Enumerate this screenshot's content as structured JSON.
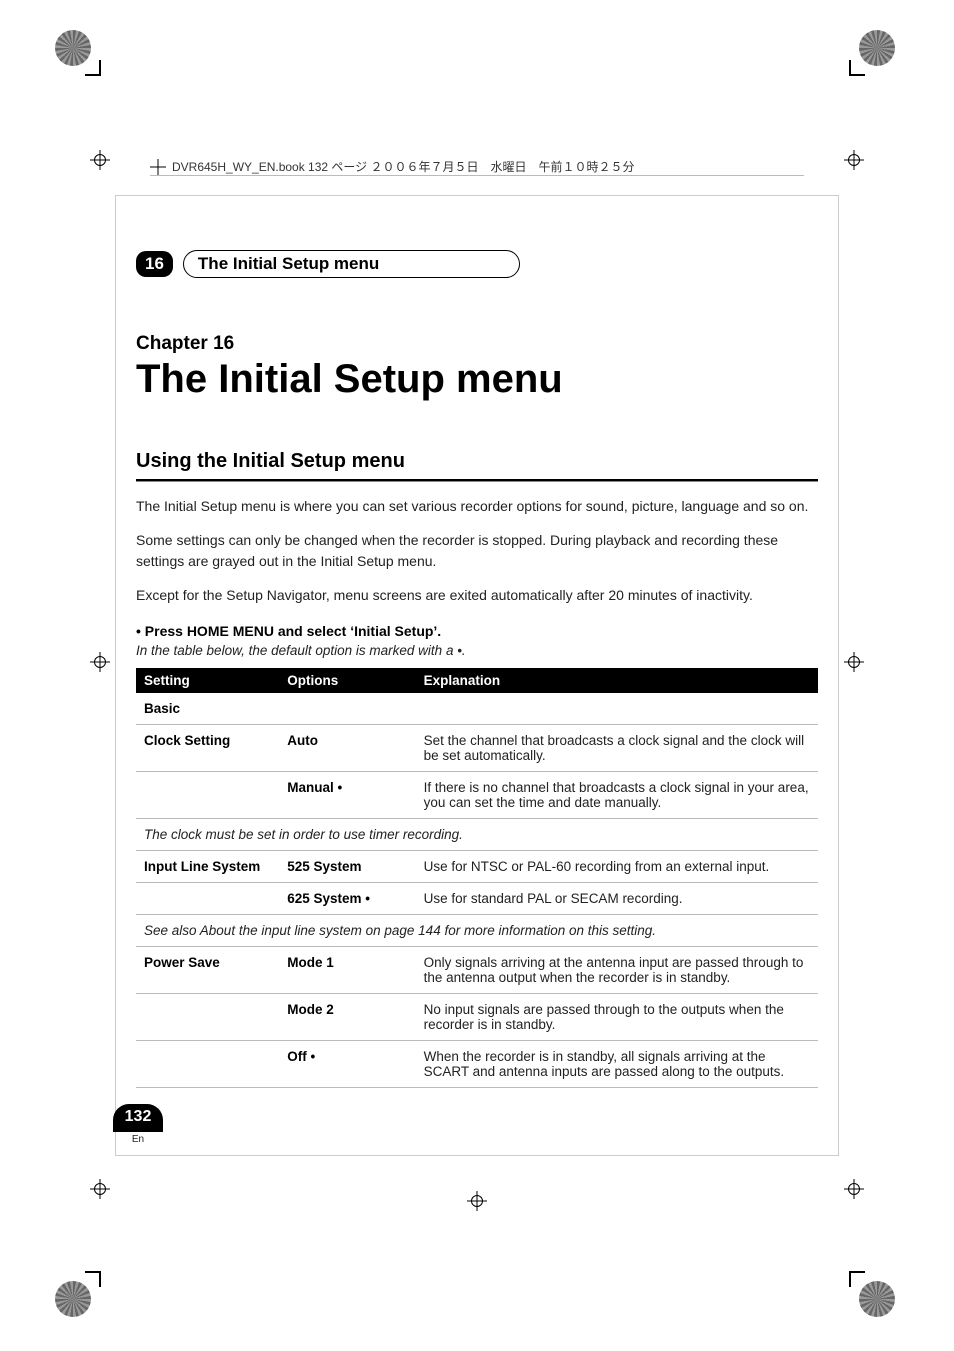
{
  "bookmeta": "DVR645H_WY_EN.book  132 ページ  ２００６年７月５日　水曜日　午前１０時２５分",
  "header": {
    "chapnum": "16",
    "chaptitle_pill": "The Initial Setup menu"
  },
  "chapter_label": "Chapter 16",
  "chapter_title": "The Initial Setup menu",
  "section_title": "Using the Initial Setup menu",
  "paras": {
    "p1": "The Initial Setup menu is where you can set various recorder options for sound, picture, language and so on.",
    "p2": "Some settings can only be changed when the recorder is stopped. During playback and recording these settings are grayed out in the Initial Setup menu.",
    "p3": "Except for the Setup Navigator, menu screens are exited automatically after 20 minutes of inactivity."
  },
  "step": "•    Press HOME MENU and select ‘Initial Setup’.",
  "step_note": "In the table below, the default option is marked with a  •.",
  "table": {
    "head": {
      "c1": "Setting",
      "c2": "Options",
      "c3": "Explanation"
    },
    "basic_label": "Basic",
    "rows": {
      "clock_auto": {
        "setting": "Clock Setting",
        "option": "Auto",
        "expl": "Set the channel that broadcasts a clock signal and the clock will be set automatically."
      },
      "clock_manual": {
        "setting": "",
        "option": "Manual •",
        "expl": "If there is no channel that broadcasts a clock signal in your area, you can set the time and date manually."
      },
      "clock_note": "The clock must be set in order to use timer recording.",
      "ils_525": {
        "setting": "Input Line System",
        "option": "525 System",
        "expl": "Use for NTSC or PAL-60 recording from an external input."
      },
      "ils_625": {
        "setting": "",
        "option": "625 System •",
        "expl": "Use for standard PAL or SECAM recording."
      },
      "ils_note": "See also About the input line system on page 144 for more information on this setting.",
      "ps_m1": {
        "setting": "Power Save",
        "option": "Mode 1",
        "expl": "Only signals arriving at the antenna input are passed through to the antenna output when the recorder is in standby."
      },
      "ps_m2": {
        "setting": "",
        "option": "Mode 2",
        "expl": "No input signals are passed through to the outputs when the recorder is in standby."
      },
      "ps_off": {
        "setting": "",
        "option": "Off •",
        "expl": "When the recorder is in standby, all signals arriving at the SCART and antenna inputs are passed along to the outputs."
      }
    }
  },
  "page": {
    "num": "132",
    "lang": "En"
  }
}
